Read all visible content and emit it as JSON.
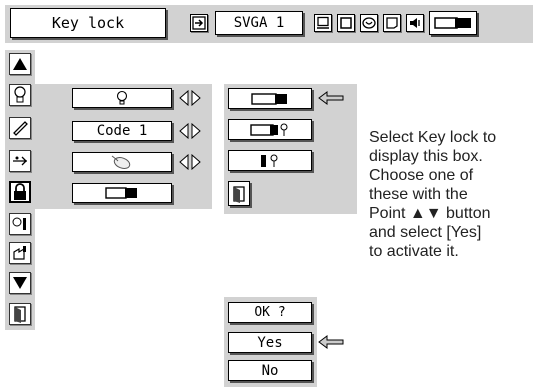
{
  "header": {
    "title": "Key lock",
    "input_label": "SVGA 1"
  },
  "menu": {
    "rows": [
      {
        "value": ""
      },
      {
        "value": "Code 1"
      },
      {
        "value": ""
      },
      {
        "value": ""
      }
    ]
  },
  "confirm": {
    "question": "OK ?",
    "yes": "Yes",
    "no": "No"
  },
  "help_text": "Select Key lock to\ndisplay this box.\nChoose one of\nthese with the\nPoint ▲▼ button\nand select [Yes]\nto activate it."
}
